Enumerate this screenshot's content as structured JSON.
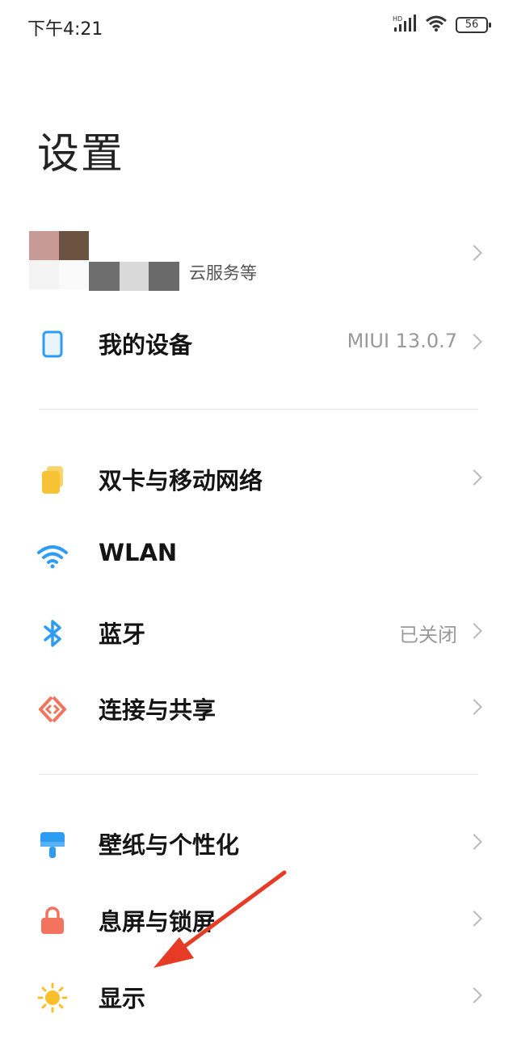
{
  "status_bar": {
    "time": "下午4:21",
    "network_label": "HD",
    "battery": "56"
  },
  "page": {
    "title": "设置"
  },
  "account": {
    "subtitle": "云服务等"
  },
  "sections": {
    "my_device": {
      "label": "我的设备",
      "value": "MIUI 13.0.7",
      "icon": "tablet-icon"
    },
    "sim": {
      "label": "双卡与移动网络",
      "icon": "sim-cards-icon"
    },
    "wlan": {
      "label": "WLAN",
      "icon": "wifi-icon"
    },
    "bluetooth": {
      "label": "蓝牙",
      "value": "已关闭",
      "icon": "bluetooth-icon"
    },
    "connection": {
      "label": "连接与共享",
      "icon": "connection-share-icon"
    },
    "wallpaper": {
      "label": "壁纸与个性化",
      "icon": "brush-icon"
    },
    "lockscreen": {
      "label": "息屏与锁屏",
      "icon": "lock-icon"
    },
    "display": {
      "label": "显示",
      "icon": "sun-icon"
    }
  },
  "colors": {
    "accent_blue": "#2f9cf3",
    "sim_yellow": "#f8c236",
    "connection_red": "#f0745e",
    "lock_red": "#f2735e",
    "sun_yellow": "#fbbf2c",
    "annotation_arrow": "#e63b24"
  }
}
